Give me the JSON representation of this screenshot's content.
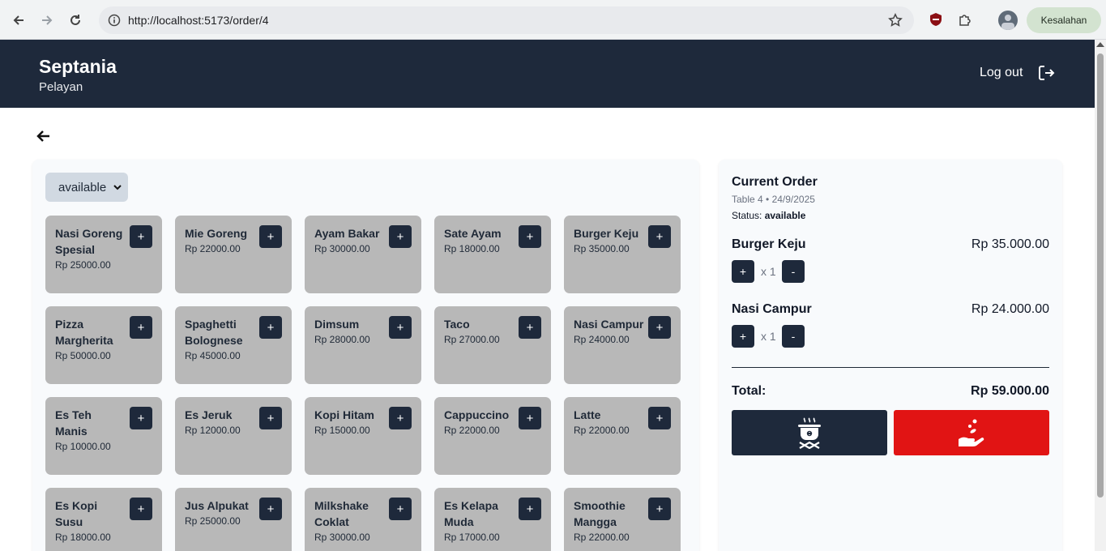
{
  "browser": {
    "url": "http://localhost:5173/order/4",
    "error_chip": "Kesalahan"
  },
  "header": {
    "user_name": "Septania",
    "user_role": "Pelayan",
    "logout_label": "Log out"
  },
  "menu": {
    "filter_value": "available",
    "items": [
      {
        "name": "Nasi Goreng Spesial",
        "price": "Rp 25000.00"
      },
      {
        "name": "Mie Goreng",
        "price": "Rp 22000.00"
      },
      {
        "name": "Ayam Bakar",
        "price": "Rp 30000.00"
      },
      {
        "name": "Sate Ayam",
        "price": "Rp 18000.00"
      },
      {
        "name": "Burger Keju",
        "price": "Rp 35000.00"
      },
      {
        "name": "Pizza Margherita",
        "price": "Rp 50000.00"
      },
      {
        "name": "Spaghetti Bolognese",
        "price": "Rp 45000.00"
      },
      {
        "name": "Dimsum",
        "price": "Rp 28000.00"
      },
      {
        "name": "Taco",
        "price": "Rp 27000.00"
      },
      {
        "name": "Nasi Campur",
        "price": "Rp 24000.00"
      },
      {
        "name": "Es Teh Manis",
        "price": "Rp 10000.00"
      },
      {
        "name": "Es Jeruk",
        "price": "Rp 12000.00"
      },
      {
        "name": "Kopi Hitam",
        "price": "Rp 15000.00"
      },
      {
        "name": "Cappuccino",
        "price": "Rp 22000.00"
      },
      {
        "name": "Latte",
        "price": "Rp 22000.00"
      },
      {
        "name": "Es Kopi Susu",
        "price": "Rp 18000.00"
      },
      {
        "name": "Jus Alpukat",
        "price": "Rp 25000.00"
      },
      {
        "name": "Milkshake Coklat",
        "price": "Rp 30000.00"
      },
      {
        "name": "Es Kelapa Muda",
        "price": "Rp 17000.00"
      },
      {
        "name": "Smoothie Mangga",
        "price": "Rp 22000.00"
      }
    ],
    "add_label": "+"
  },
  "order": {
    "title": "Current Order",
    "meta": "Table 4 • 24/9/2025",
    "status_label": "Status:",
    "status_value": "available",
    "items": [
      {
        "name": "Burger Keju",
        "price": "Rp 35.000.00",
        "qty": "x 1"
      },
      {
        "name": "Nasi Campur",
        "price": "Rp 24.000.00",
        "qty": "x 1"
      }
    ],
    "plus_label": "+",
    "minus_label": "-",
    "total_label": "Total:",
    "total_value": "Rp 59.000.00",
    "actions": [
      {
        "icon": "cooking-pot-icon",
        "color": "#1e293b"
      },
      {
        "icon": "hand-pay-icon",
        "color": "#e11414"
      }
    ]
  },
  "colors": {
    "header_bg": "#1e293b",
    "card_bg": "#b8b8b8",
    "pay_red": "#e11414"
  }
}
